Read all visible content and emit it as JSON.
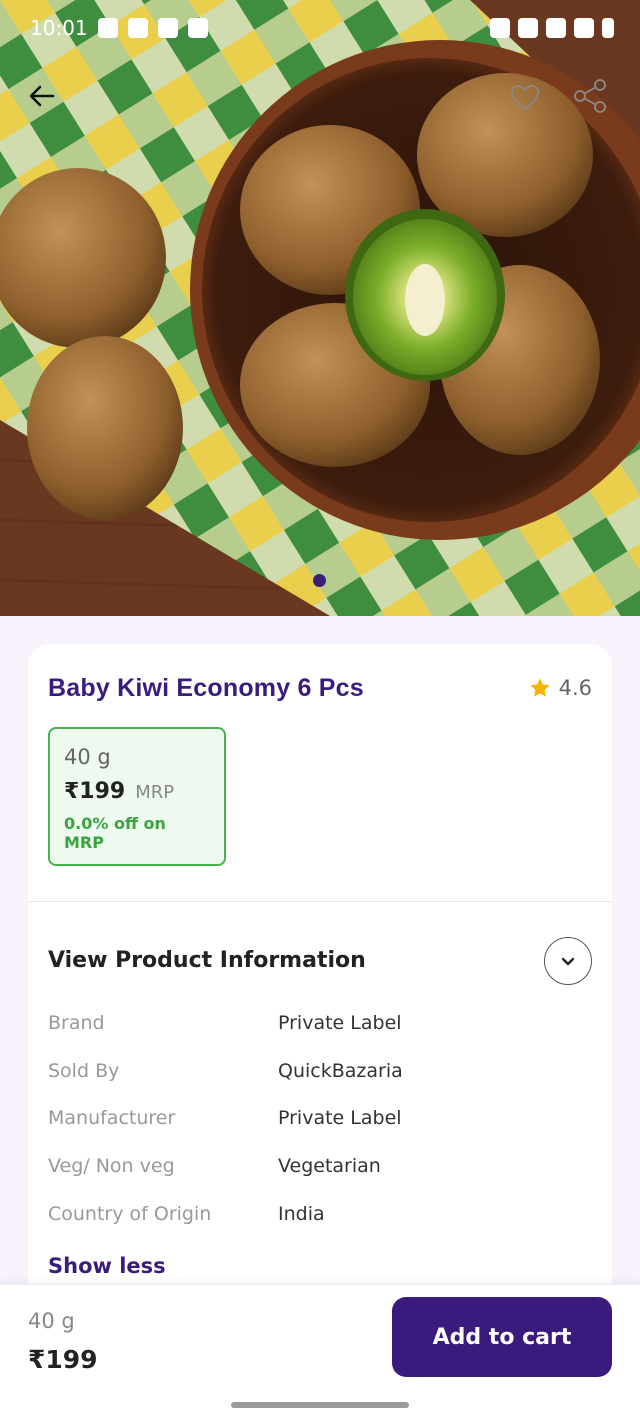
{
  "statusbar": {
    "time": "10:01"
  },
  "product": {
    "name": "Baby Kiwi Economy 6 Pcs",
    "rating": "4.6",
    "variant": {
      "weight": "40 g",
      "price": "₹199",
      "mrp_label": "MRP",
      "discount": "0.0% off on MRP"
    }
  },
  "info": {
    "title": "View Product Information",
    "rows": [
      {
        "key": "Brand",
        "value": "Private Label"
      },
      {
        "key": "Sold By",
        "value": "QuickBazaria"
      },
      {
        "key": "Manufacturer",
        "value": "Private Label"
      },
      {
        "key": "Veg/ Non veg",
        "value": "Vegetarian"
      },
      {
        "key": "Country of Origin",
        "value": "India"
      }
    ],
    "show_less": "Show less"
  },
  "bottom_bar": {
    "weight": "40 g",
    "price": "₹199",
    "add_to_cart": "Add to cart"
  },
  "colors": {
    "brand": "#3b1a7e",
    "discount_green": "#3aa43f",
    "star": "#f5b400"
  },
  "icons": [
    "back-arrow-icon",
    "heart-icon",
    "share-icon",
    "star-icon",
    "chevron-down-icon"
  ]
}
